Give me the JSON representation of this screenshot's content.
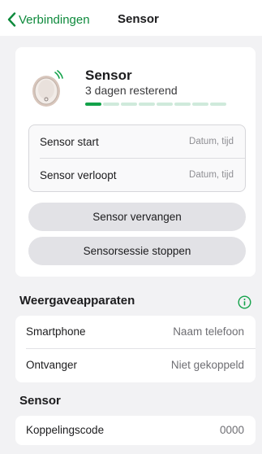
{
  "navbar": {
    "back_label": "Verbindingen",
    "title": "Sensor",
    "accent_color": "#0e8a3c"
  },
  "sensor": {
    "name": "Sensor",
    "remaining": "3 dagen resterend",
    "progress": {
      "segments_total": 8,
      "segments_filled": 1,
      "fill_color": "#13a24a",
      "track_color": "#cfeadb"
    },
    "icon": "sensor-device-icon",
    "details": [
      {
        "label": "Sensor start",
        "value": "Datum, tijd"
      },
      {
        "label": "Sensor verloopt",
        "value": "Datum, tijd"
      }
    ],
    "replace_button": "Sensor vervangen",
    "stop_button": "Sensorsessie stoppen"
  },
  "devices_section": {
    "title": "Weergaveapparaten",
    "info_icon": "info-circle-icon",
    "rows": [
      {
        "label": "Smartphone",
        "value": "Naam telefoon"
      },
      {
        "label": "Ontvanger",
        "value": "Niet gekoppeld"
      }
    ]
  },
  "sensor_section": {
    "title": "Sensor",
    "rows": [
      {
        "label": "Koppelingscode",
        "value": "0000"
      }
    ]
  }
}
